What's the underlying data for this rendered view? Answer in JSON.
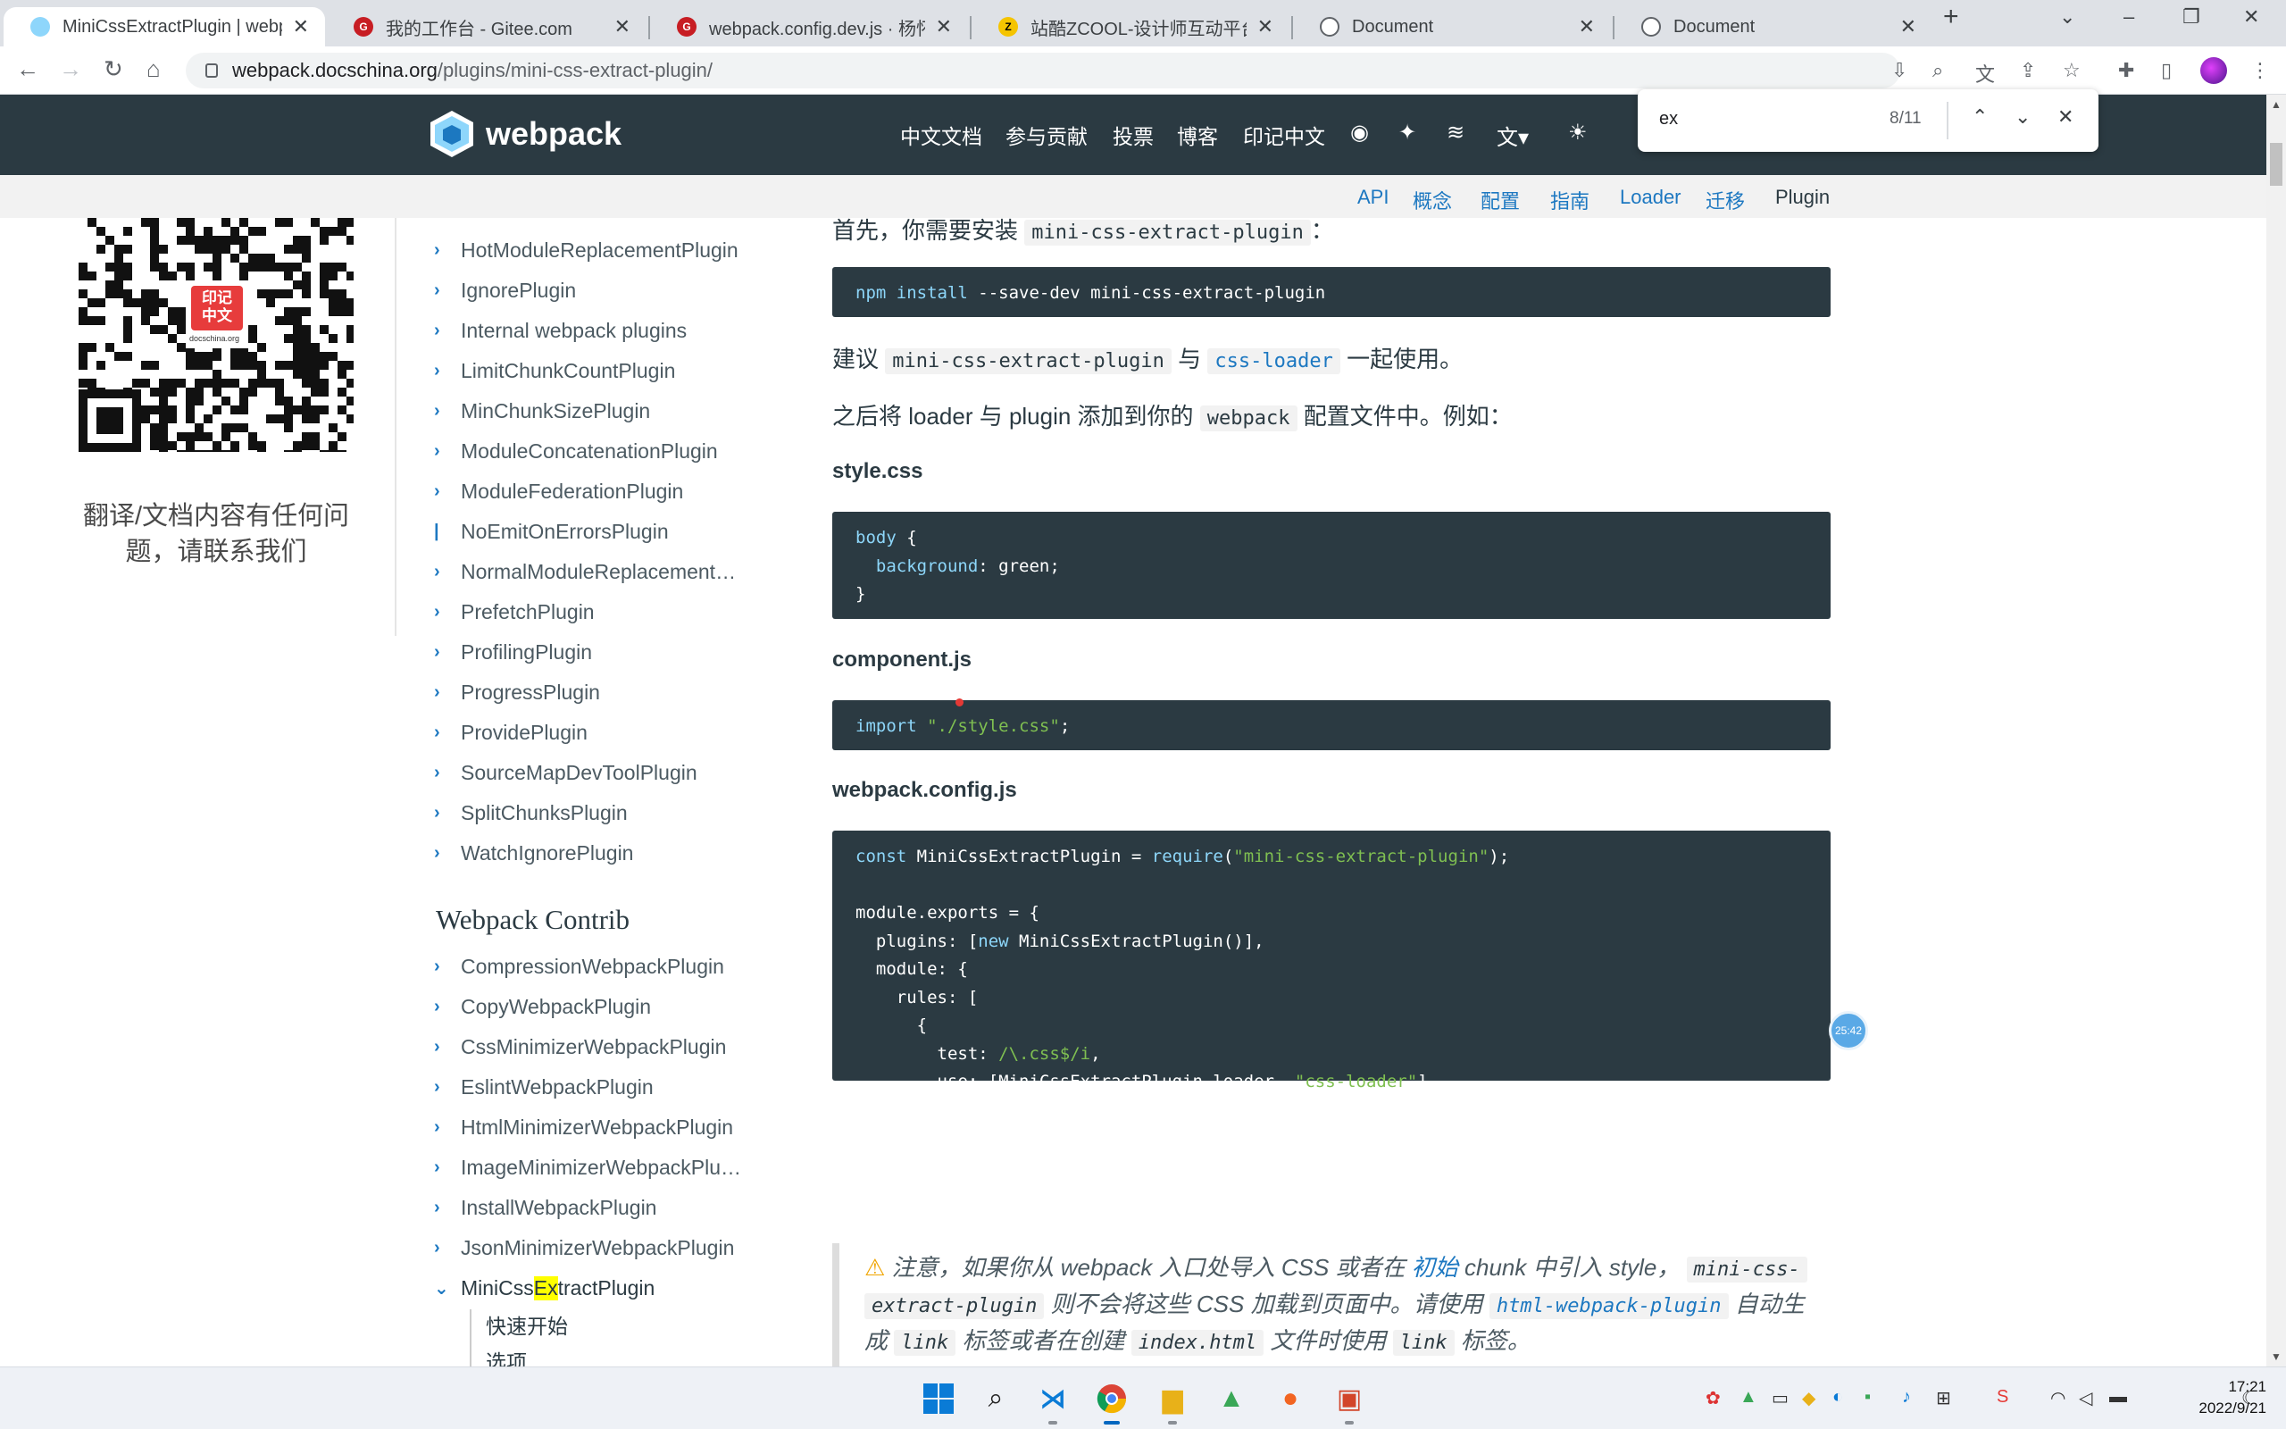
{
  "browser": {
    "tabs": [
      {
        "title": "MiniCssExtractPlugin | webpack",
        "active": true
      },
      {
        "title": "我的工作台 - Gitee.com",
        "active": false
      },
      {
        "title": "webpack.config.dev.js · 杨怀智",
        "active": false
      },
      {
        "title": "站酷ZCOOL-设计师互动平台-打",
        "active": false
      },
      {
        "title": "Document",
        "active": false
      },
      {
        "title": "Document",
        "active": false
      }
    ],
    "url_host": "webpack.docschina.org",
    "url_path": "/plugins/mini-css-extract-plugin/"
  },
  "find": {
    "query": "ex",
    "count": "8/11"
  },
  "header": {
    "logo": "webpack",
    "nav": [
      "中文文档",
      "参与贡献",
      "投票",
      "博客",
      "印记中文"
    ],
    "subnav": [
      "API",
      "概念",
      "配置",
      "指南",
      "Loader",
      "迁移",
      "Plugin"
    ]
  },
  "left": {
    "qr_badge_line1": "印记",
    "qr_badge_line2": "中文",
    "qr_caption": "docschina.org",
    "help_text": "翻译/文档内容有任何问题，请联系我们"
  },
  "sidebar": {
    "plugins": [
      "HotModuleReplacementPlugin",
      "IgnorePlugin",
      "Internal webpack plugins",
      "LimitChunkCountPlugin",
      "MinChunkSizePlugin",
      "ModuleConcatenationPlugin",
      "ModuleFederationPlugin",
      "NoEmitOnErrorsPlugin",
      "NormalModuleReplacement…",
      "PrefetchPlugin",
      "ProfilingPlugin",
      "ProgressPlugin",
      "ProvidePlugin",
      "SourceMapDevToolPlugin",
      "SplitChunksPlugin",
      "WatchIgnorePlugin"
    ],
    "contrib_heading": "Webpack Contrib",
    "contrib": [
      "CompressionWebpackPlugin",
      "CopyWebpackPlugin",
      "CssMinimizerWebpackPlugin",
      "EslintWebpackPlugin",
      "HtmlMinimizerWebpackPlugin",
      "ImageMinimizerWebpackPlu…",
      "InstallWebpackPlugin",
      "JsonMinimizerWebpackPlugin"
    ],
    "active_pre": "MiniCss",
    "active_hl": "Ex",
    "active_post": "tractPlugin",
    "subitems": [
      "快速开始",
      "选项"
    ]
  },
  "content": {
    "intro_pre": "首先，你需要安装",
    "intro_code": "mini-css-extract-plugin",
    "intro_post": "：",
    "install_cmd_1": "npm install",
    "install_cmd_2": " --save-dev mini-css-extract-plugin",
    "recommend_pre": "建议",
    "recommend_code1": "mini-css-extract-plugin",
    "recommend_mid": "与",
    "recommend_code2": "css-loader",
    "recommend_post": "一起使用。",
    "add_pre": "之后将 loader 与 plugin 添加到你的",
    "add_code": "webpack",
    "add_post": "配置文件中。例如：",
    "file1": "style.css",
    "file2": "component.js",
    "file3": "webpack.config.js",
    "note_line1_pre": "注意，如果你从 webpack 入口处导入 CSS 或者在",
    "note_link": "初始",
    "note_line1_mid": "chunk 中引入 style，",
    "note_code1": "mini-css-",
    "note_line2_code": "extract-plugin",
    "note_line2_mid": "则不会将这些 CSS 加载到页面中。请使用",
    "note_code2": "html-webpack-plugin",
    "note_line2_post": "自动生",
    "note_line3_pre": "成",
    "note_code3": "link",
    "note_line3_mid": "标签或者在创建",
    "note_code4": "index.html",
    "note_line3_mid2": "文件时使用",
    "note_code5": "link",
    "note_line3_post": "标签。"
  },
  "timer": "25:42",
  "clock": {
    "time": "17:21",
    "date": "2022/9/21"
  }
}
